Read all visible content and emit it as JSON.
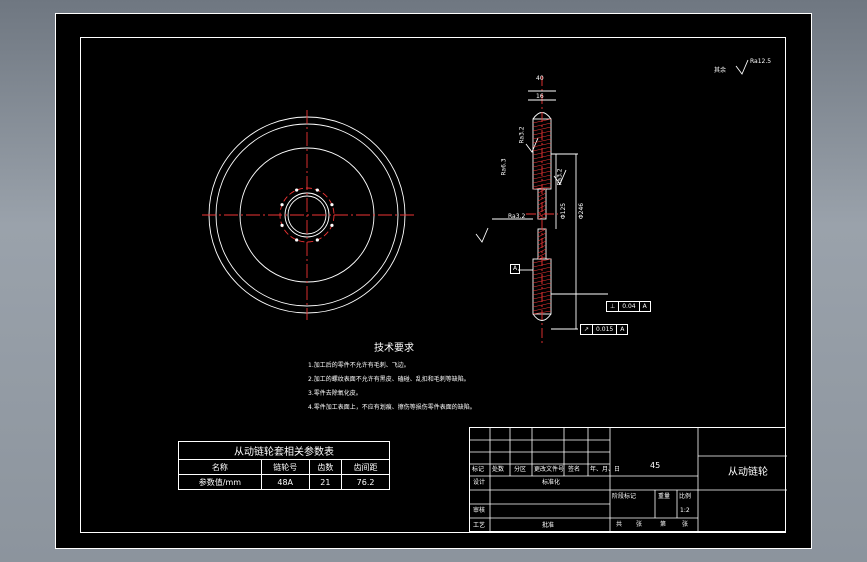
{
  "drawing": {
    "surface_finish_note": {
      "prefix": "其余",
      "value": "Ra12.5"
    },
    "tech_requirements": {
      "title": "技术要求",
      "items": [
        "1.加工后的零件不允许有毛刺、飞边。",
        "2.加工的螺纹表面不允许有黑皮、磕碰、乱扣和毛刺等缺陷。",
        "3.零件去除氧化皮。",
        "4.零件加工表面上，不应有划痕、擦伤等损伤零件表面的缺陷。"
      ]
    },
    "section_labels": {
      "dim_top1": "40",
      "dim_top2": "16",
      "ra_left": "Ra3.2",
      "ra_right": "Ra3.2",
      "ra_mid": "Ra6.3",
      "ra_hub": "Ra3.2",
      "bore": "Φ125",
      "outer": "Φ246",
      "datum": "A",
      "tol1": {
        "sym": "⊥",
        "val": "0.04",
        "ref": "A"
      },
      "tol2": {
        "sym": "↗",
        "val": "0.015",
        "ref": "A"
      }
    },
    "param_table": {
      "title": "从动链轮套相关参数表",
      "headers": [
        "名称",
        "链轮号",
        "齿数",
        "齿间距"
      ],
      "row": [
        "参数值/mm",
        "48A",
        "21",
        "76.2"
      ]
    },
    "title_block": {
      "material": "45",
      "part_name": "从动链轮",
      "row_labels": [
        "标记",
        "处数",
        "分区",
        "更改文件号",
        "签名",
        "年、月、日"
      ],
      "design": "设计",
      "standard": "标准化",
      "stage": "阶段标记",
      "weight": "重量",
      "scale": "比例",
      "scale_value": "1:2",
      "review": "审核",
      "process": "工艺",
      "approve": "批准",
      "sheets": [
        "共",
        "张",
        "第",
        "张"
      ]
    }
  }
}
